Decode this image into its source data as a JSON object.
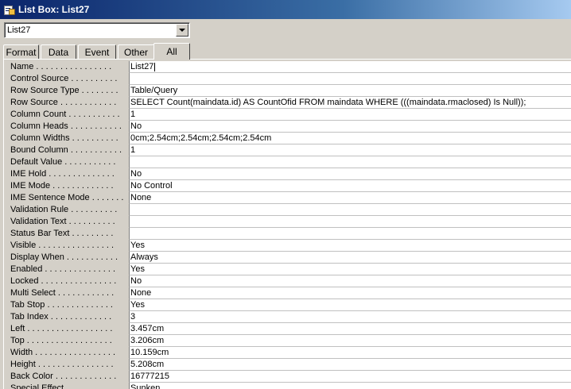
{
  "window": {
    "title": "List Box: List27"
  },
  "selector": {
    "value": "List27"
  },
  "tabs": [
    {
      "label": "Format",
      "active": false
    },
    {
      "label": "Data",
      "active": false
    },
    {
      "label": "Event",
      "active": false
    },
    {
      "label": "Other",
      "active": false
    },
    {
      "label": "All",
      "active": true
    }
  ],
  "properties": [
    {
      "name": "Name . . . . . . . . . . . . . . . .",
      "value": "List27"
    },
    {
      "name": "Control Source . . . . . . . . . .",
      "value": ""
    },
    {
      "name": "Row Source Type . . . . . . . .",
      "value": "Table/Query"
    },
    {
      "name": "Row Source . . . . . . . . . . . .",
      "value": "SELECT Count(maindata.id) AS CountOfid FROM maindata WHERE (((maindata.rmaclosed) Is Null));"
    },
    {
      "name": "Column Count . . . . . . . . . . .",
      "value": "1"
    },
    {
      "name": "Column Heads . . . . . . . . . . .",
      "value": "No"
    },
    {
      "name": "Column Widths . . . . . . . . . .",
      "value": "0cm;2.54cm;2.54cm;2.54cm;2.54cm"
    },
    {
      "name": "Bound Column . . . . . . . . . . .",
      "value": "1"
    },
    {
      "name": "Default Value . . . . . . . . . . .",
      "value": ""
    },
    {
      "name": "IME Hold . . . . . . . . . . . . . .",
      "value": "No"
    },
    {
      "name": "IME Mode . . . . . . . . . . . . .",
      "value": "No Control"
    },
    {
      "name": "IME Sentence Mode . . . . . . .",
      "value": "None"
    },
    {
      "name": "Validation Rule . . . . . . . . . .",
      "value": ""
    },
    {
      "name": "Validation Text . . . . . . . . . .",
      "value": ""
    },
    {
      "name": "Status Bar Text . . . . . . . . .",
      "value": ""
    },
    {
      "name": "Visible . . . . . . . . . . . . . . . .",
      "value": "Yes"
    },
    {
      "name": "Display When . . . . . . . . . . .",
      "value": "Always"
    },
    {
      "name": "Enabled . . . . . . . . . . . . . . .",
      "value": "Yes"
    },
    {
      "name": "Locked . . . . . . . . . . . . . . . .",
      "value": "No"
    },
    {
      "name": "Multi Select . . . . . . . . . . . .",
      "value": "None"
    },
    {
      "name": "Tab Stop . . . . . . . . . . . . . .",
      "value": "Yes"
    },
    {
      "name": "Tab Index . . . . . . . . . . . . .",
      "value": "3"
    },
    {
      "name": "Left . . . . . . . . . . . . . . . . . .",
      "value": "3.457cm"
    },
    {
      "name": "Top . . . . . . . . . . . . . . . . . .",
      "value": "3.206cm"
    },
    {
      "name": "Width . . . . . . . . . . . . . . . . .",
      "value": "10.159cm"
    },
    {
      "name": "Height . . . . . . . . . . . . . . . .",
      "value": "5.208cm"
    },
    {
      "name": "Back Color . . . . . . . . . . . . .",
      "value": "16777215"
    },
    {
      "name": "Special Effect . . . . . . . . . . .",
      "value": "Sunken"
    }
  ]
}
